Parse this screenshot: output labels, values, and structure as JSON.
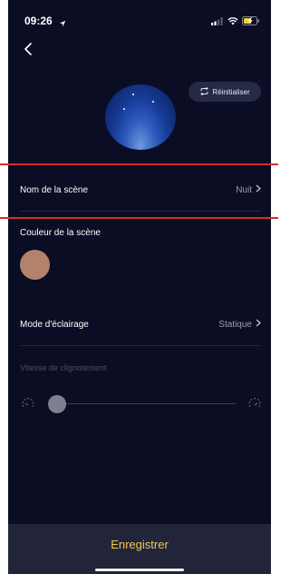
{
  "status_bar": {
    "time": "09:26"
  },
  "header": {
    "reset_label": "Réinitialiser"
  },
  "scene_name": {
    "label": "Nom de la scène",
    "value": "Nuit"
  },
  "scene_color": {
    "label": "Couleur de la scène",
    "swatch_color": "#b3826a"
  },
  "lighting_mode": {
    "label": "Mode d'éclairage",
    "value": "Statique"
  },
  "blink_speed": {
    "label": "Vitesse de clignotement",
    "level": 0
  },
  "footer": {
    "save_label": "Enregistrer"
  },
  "colors": {
    "background": "#0b0d24",
    "accent": "#f4c84e",
    "highlight": "#d62c2c"
  }
}
